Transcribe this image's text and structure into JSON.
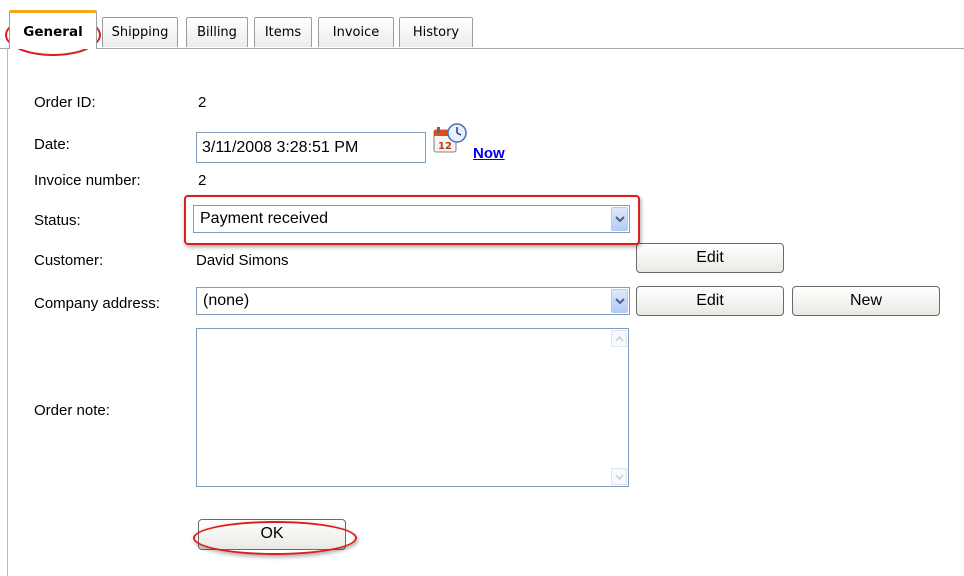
{
  "tabs": [
    "General",
    "Shipping",
    "Billing",
    "Items",
    "Invoice",
    "History"
  ],
  "form": {
    "order_id_label": "Order ID:",
    "order_id": "2",
    "date_label": "Date:",
    "date_value": "3/11/2008 3:28:51 PM",
    "calendar_badge": "12",
    "now_link": "Now",
    "invoice_label": "Invoice number:",
    "invoice_number": "2",
    "status_label": "Status:",
    "status_value": "Payment received",
    "customer_label": "Customer:",
    "customer_name": "David Simons",
    "company_label": "Company address:",
    "company_value": "(none)",
    "note_label": "Order note:",
    "note_value": ""
  },
  "buttons": {
    "edit_customer": "Edit",
    "edit_address": "Edit",
    "new_address": "New",
    "ok": "OK"
  },
  "icons": {
    "calendar": "calendar-clock-icon",
    "dropdown": "chevron-down-icon",
    "scroll_up": "scroll-up-arrow-icon",
    "scroll_down": "scroll-down-arrow-icon"
  },
  "colors": {
    "highlight_ring": "#dd1c1c",
    "active_tab_accent": "#f0a820",
    "link": "#0000ee"
  }
}
